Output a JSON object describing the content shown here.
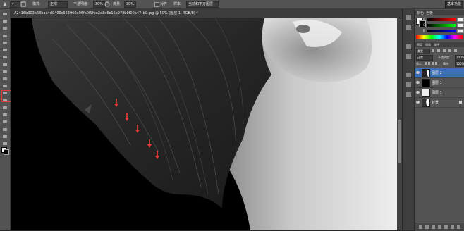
{
  "options_bar": {
    "mode_label": "模式:",
    "mode_value": "正常",
    "opacity_label": "不透明度:",
    "opacity_value": "30%",
    "flow_label": "流量:",
    "flow_value": "30%",
    "align_label": "对齐",
    "sample_label": "样本:",
    "sample_value": "当前和下方图层",
    "workspace_button": "基本功能"
  },
  "document": {
    "title": "A2416b903a63bae4d0499c663960a96fa0f9fee2a3d6c16a973b0f00a47_b0.jpg @ 50% (图层 1, RGB/8) *"
  },
  "colors": {
    "accent_highlight": "#e33b3b",
    "selection": "#3d6fb4",
    "arrow": "#e83a3a"
  },
  "color_panel": {
    "tabs": [
      "颜色",
      "色板"
    ],
    "channel_labels": [
      "R",
      "G",
      "B"
    ]
  },
  "layers_panel": {
    "tabs": [
      "图层",
      "通道",
      "路径"
    ],
    "kind_label": "类型",
    "blend_mode": "正常",
    "opacity_label": "不透明度:",
    "opacity_value": "100%",
    "lock_label": "锁定:",
    "fill_label": "填充:",
    "fill_value": "100%",
    "layers": [
      {
        "name": "图层 2",
        "selected": true
      },
      {
        "name": "图层 1",
        "selected": false
      },
      {
        "name": "图层 1",
        "selected": false
      },
      {
        "name": "背景",
        "selected": false
      }
    ]
  },
  "annotations": {
    "arrow_count": 5
  }
}
